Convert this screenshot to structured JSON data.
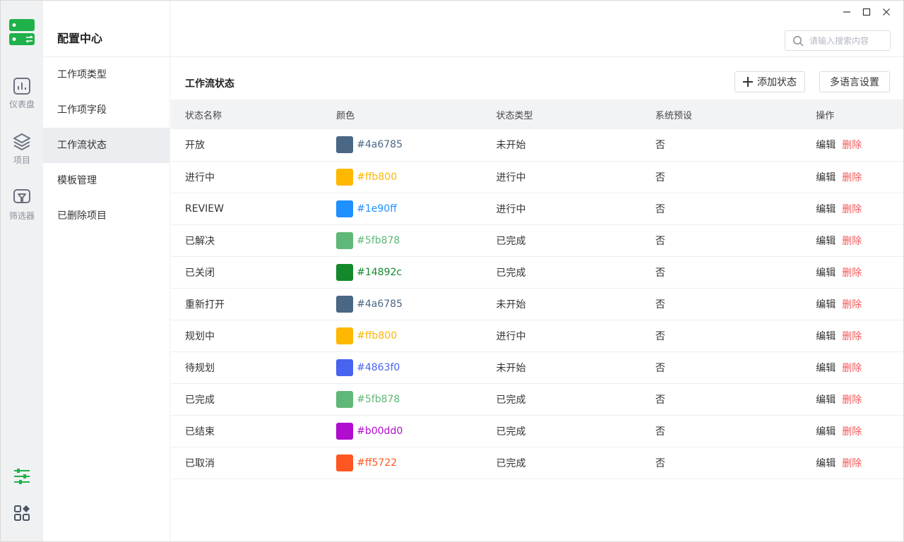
{
  "rail": {
    "items": [
      {
        "label": "仪表盘",
        "icon": "dashboard-icon"
      },
      {
        "label": "项目",
        "icon": "layers-icon"
      },
      {
        "label": "筛选器",
        "icon": "filter-icon"
      }
    ],
    "bottom_icons": [
      "settings-sliders-icon",
      "apps-grid-icon"
    ],
    "accent": "#1fb14a"
  },
  "nav": {
    "title": "配置中心",
    "items": [
      {
        "label": "工作项类型"
      },
      {
        "label": "工作项字段"
      },
      {
        "label": "工作流状态",
        "active": true
      },
      {
        "label": "模板管理"
      },
      {
        "label": "已删除项目"
      }
    ]
  },
  "search": {
    "placeholder": "请输入搜索内容"
  },
  "main": {
    "title": "工作流状态",
    "add_button": "添加状态",
    "lang_button": "多语言设置",
    "columns": [
      "状态名称",
      "颜色",
      "状态类型",
      "系统预设",
      "操作"
    ],
    "edit_label": "编辑",
    "delete_label": "删除",
    "rows": [
      {
        "name": "开放",
        "color": "#4a6785",
        "type": "未开始",
        "preset": "否"
      },
      {
        "name": "进行中",
        "color": "#ffb800",
        "type": "进行中",
        "preset": "否"
      },
      {
        "name": "REVIEW",
        "color": "#1e90ff",
        "type": "进行中",
        "preset": "否"
      },
      {
        "name": "已解决",
        "color": "#5fb878",
        "type": "已完成",
        "preset": "否"
      },
      {
        "name": "已关闭",
        "color": "#14892c",
        "type": "已完成",
        "preset": "否"
      },
      {
        "name": "重新打开",
        "color": "#4a6785",
        "type": "未开始",
        "preset": "否"
      },
      {
        "name": "规划中",
        "color": "#ffb800",
        "type": "进行中",
        "preset": "否"
      },
      {
        "name": "待规划",
        "color": "#4863f0",
        "type": "未开始",
        "preset": "否"
      },
      {
        "name": "已完成",
        "color": "#5fb878",
        "type": "已完成",
        "preset": "否"
      },
      {
        "name": "已结束",
        "color": "#b00dd0",
        "type": "已完成",
        "preset": "否"
      },
      {
        "name": "已取消",
        "color": "#ff5722",
        "type": "已完成",
        "preset": "否"
      }
    ]
  }
}
